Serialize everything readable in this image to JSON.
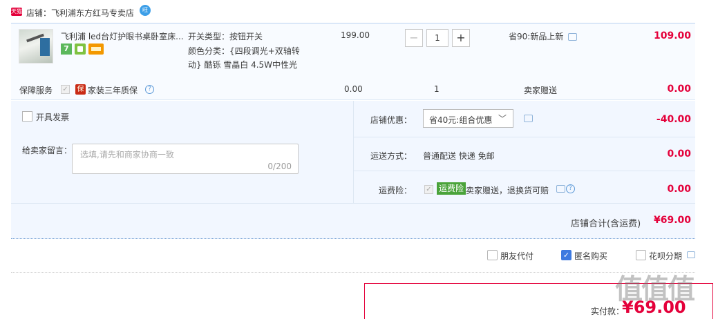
{
  "shop": {
    "logo_text": "天猫",
    "name_label": "店铺：飞利浦东方红马专卖店",
    "wangwang": "旺"
  },
  "item": {
    "title": "飞利浦 led台灯护眼书桌卧室床...",
    "badges": [
      "7"
    ],
    "sku": {
      "switch_type": "开关类型：按钮开关",
      "color_line1": "颜色分类：{四段调光+双轴转",
      "color_line2": "动} 酷铄 雪晶白 4.5W中性光"
    },
    "unit_price": "199.00",
    "quantity": {
      "minus": "−",
      "value": "1",
      "plus": "+"
    },
    "discount_note": "省90:新品上新",
    "total": "109.00"
  },
  "guarantee": {
    "label": "保障服务",
    "check": "✓",
    "badge": "保",
    "text": "家装三年质保",
    "help": "?",
    "price": "0.00",
    "qty": "1",
    "gift": "卖家赠送",
    "total": "0.00"
  },
  "options": {
    "invoice_label": "开具发票",
    "message_label": "给卖家留言：",
    "message_placeholder": "选填,请先和商家协商一致",
    "message_counter": "0/200",
    "shop_discount_label": "店铺优惠：",
    "shop_discount_value": "省40元:组合优惠",
    "shop_discount_chevron": "﹀",
    "shop_discount_amount": "-40.00",
    "shipping_label": "运送方式：",
    "shipping_value": "普通配送 快递 免邮",
    "shipping_amount": "0.00",
    "freight_label": "运费险：",
    "freight_check": "✓",
    "freight_badge": "运费险",
    "freight_text": "卖家赠送，退换货可赔",
    "freight_help": "?",
    "freight_amount": "0.00",
    "shop_total_label": "店铺合计(含运费)",
    "shop_total_amount": "¥69.00"
  },
  "bottom": {
    "friend_pay": "朋友代付",
    "anonymous": "匿名购买",
    "anonymous_check": "✓",
    "huabei": "花呗分期"
  },
  "pay": {
    "label": "实付款：",
    "amount": "¥69.00"
  },
  "watermark": "值值值",
  "colors": {
    "price_red": "#e4003a",
    "options_bg": "#f2f7ff",
    "checkbox_blue": "#3d7ae0",
    "freight_green": "#4aa33a"
  }
}
